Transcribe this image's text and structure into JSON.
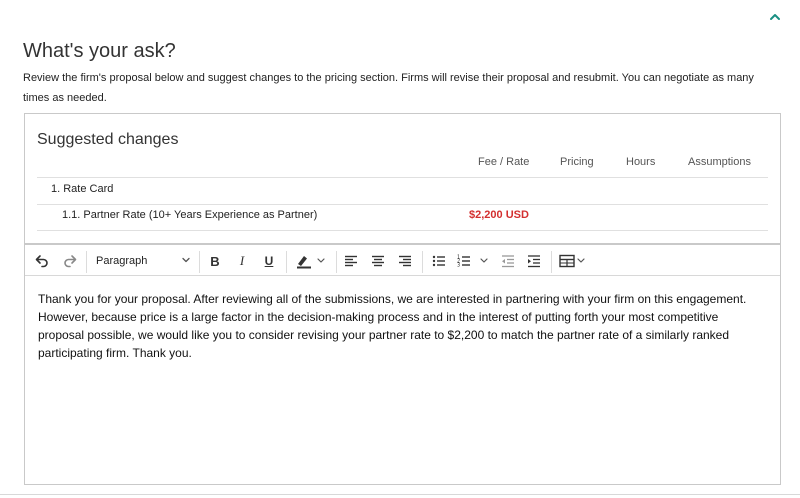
{
  "section": {
    "title": "What's your ask?",
    "description": "Review the firm's proposal below and suggest changes to the pricing section. Firms will revise their proposal and resubmit. You can negotiate as many times as needed."
  },
  "suggested": {
    "title": "Suggested changes",
    "columns": [
      "Fee / Rate",
      "Pricing",
      "Hours",
      "Assumptions"
    ],
    "rate_card_label": "1. Rate Card",
    "partner_rate_label": "1.1. Partner Rate (10+ Years Experience as Partner)",
    "partner_rate_fee": "$2,200 USD",
    "fee_color": "#d32f2f"
  },
  "toolbar": {
    "paragraph_label": "Paragraph",
    "icons": [
      "undo-icon",
      "redo-icon",
      "bold-icon",
      "italic-icon",
      "underline-icon",
      "highlight-icon",
      "align-left-icon",
      "align-center-icon",
      "align-right-icon",
      "bulleted-list-icon",
      "numbered-list-icon",
      "outdent-icon",
      "indent-icon",
      "table-icon"
    ]
  },
  "editor": {
    "content": "Thank you for your proposal. After reviewing all of the submissions, we are interested in partnering with your firm on this engagement.  However, because price is a large factor in the decision-making process and in the interest of putting forth your most competitive proposal possible, we would like you to consider revising your partner rate to $2,200 to match the partner rate of a similarly ranked participating firm. Thank you."
  },
  "accent_color": "#1a8f83"
}
